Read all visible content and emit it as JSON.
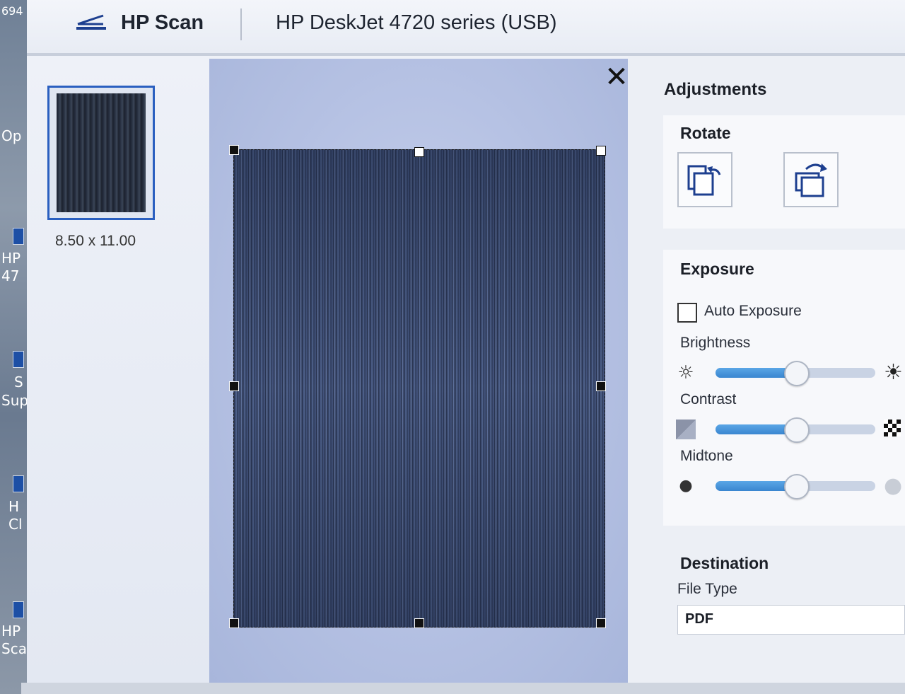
{
  "desktop": {
    "labels": [
      "694",
      "Op",
      "HP",
      "47",
      "S",
      "Sup",
      "H",
      "Cl",
      "HP",
      "Sca"
    ]
  },
  "titlebar": {
    "app_name": "HP Scan",
    "device_name": "HP DeskJet 4720 series (USB)"
  },
  "thumbnails": {
    "items": [
      {
        "size": "8.50  x  11.00"
      }
    ]
  },
  "preview": {
    "close_icon": "close-icon"
  },
  "adjustments": {
    "title": "Adjustments",
    "rotate": {
      "title": "Rotate",
      "buttons": [
        "rotate-left-icon",
        "rotate-right-icon"
      ]
    },
    "exposure": {
      "title": "Exposure",
      "auto_exposure_label": "Auto Exposure",
      "auto_exposure_checked": false,
      "sliders": [
        {
          "label": "Brightness",
          "value_fraction": 0.5,
          "left_icon": "brightness-low-icon",
          "right_icon": "brightness-high-icon"
        },
        {
          "label": "Contrast",
          "value_fraction": 0.5,
          "left_icon": "contrast-low-icon",
          "right_icon": "contrast-high-icon"
        },
        {
          "label": "Midtone",
          "value_fraction": 0.5,
          "left_icon": "midtone-dark-icon",
          "right_icon": "midtone-light-icon"
        }
      ]
    },
    "destination": {
      "title": "Destination",
      "file_type_label": "File Type",
      "file_type_value": "PDF"
    }
  },
  "colors": {
    "accent": "#3a86d0",
    "selection": "#2a5fc0"
  }
}
